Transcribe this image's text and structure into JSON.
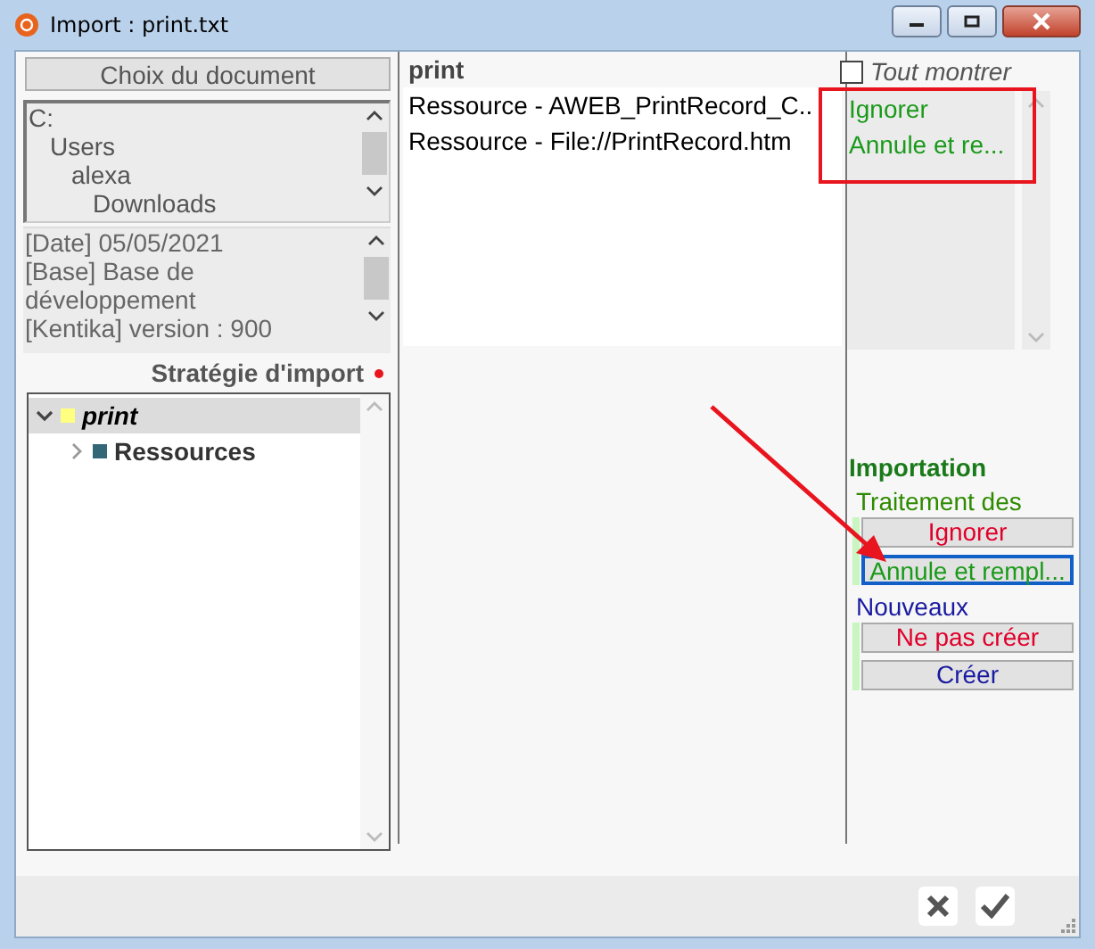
{
  "window": {
    "title": "Import : print.txt"
  },
  "left": {
    "document_button": "Choix du document",
    "folders": [
      {
        "label": "C:",
        "children": [
          {
            "label": "Users",
            "children": [
              {
                "label": "alexa",
                "children": [
                  {
                    "label": "Downloads"
                  }
                ]
              }
            ]
          }
        ]
      }
    ],
    "info_lines": [
      "[Date] 05/05/2021",
      "[Base] Base de développement",
      "[Kentika] version : 900"
    ],
    "strategy_label": "Stratégie d'import",
    "tree": [
      {
        "label": "print",
        "expanded": true,
        "selected": true,
        "color": "#ffff80",
        "children": [
          {
            "label": "Ressources",
            "expanded": false,
            "selected": false,
            "color": "#336677"
          }
        ]
      }
    ]
  },
  "middle": {
    "header": "print",
    "rows": [
      {
        "label": "Ressource - AWEB_PrintRecord_C..",
        "action": "Ignorer"
      },
      {
        "label": "Ressource - File://PrintRecord.htm",
        "action": "Annule et re..."
      }
    ]
  },
  "show_all": {
    "label": "Tout montrer",
    "checked": false
  },
  "importation": {
    "title": "Importation",
    "groups": [
      {
        "label": "Traitement des",
        "color": "#2e8b00",
        "options": [
          {
            "label": "Ignorer",
            "color": "#e0002a",
            "selected": false
          },
          {
            "label": "Annule et rempl...",
            "color": "#1a9a1a",
            "selected": true
          }
        ]
      },
      {
        "label": "Nouveaux",
        "color": "#1a1aa0",
        "options": [
          {
            "label": "Ne pas créer",
            "color": "#e0002a",
            "selected": false
          },
          {
            "label": "Créer",
            "color": "#1a1aa0",
            "selected": false
          }
        ]
      }
    ]
  }
}
